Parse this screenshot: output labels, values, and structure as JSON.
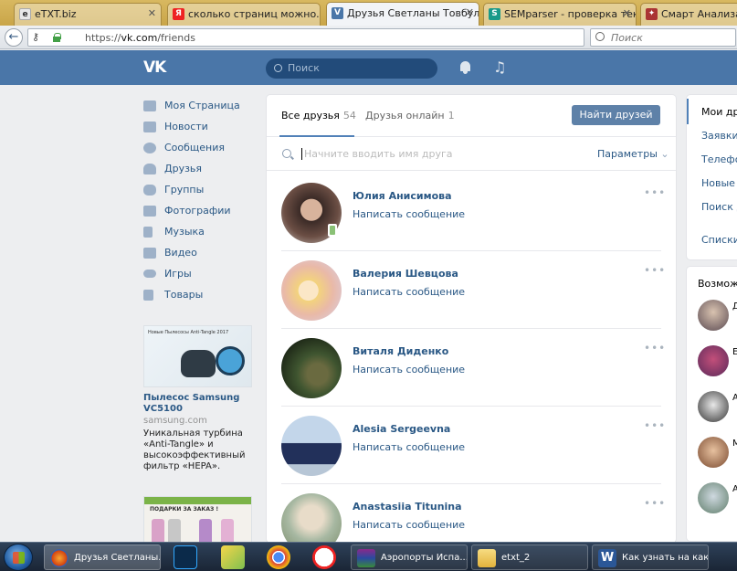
{
  "browser": {
    "tabs": [
      {
        "title": "eTXT.biz"
      },
      {
        "title": "сколько страниц можно..."
      },
      {
        "title": "Друзья Светланы Товбул..."
      },
      {
        "title": "SEMparser - проверка тек..."
      },
      {
        "title": "Смарт Анализатор"
      }
    ],
    "url_prefix": "https://",
    "url_host": "vk.com",
    "url_path": "/friends",
    "search_placeholder": "Поиск"
  },
  "vk": {
    "logo": "VK",
    "search_placeholder": "Поиск"
  },
  "sidebar": {
    "items": [
      {
        "label": "Моя Страница",
        "icon": "home-icon"
      },
      {
        "label": "Новости",
        "icon": "news-icon"
      },
      {
        "label": "Сообщения",
        "icon": "messages-icon"
      },
      {
        "label": "Друзья",
        "icon": "friends-icon"
      },
      {
        "label": "Группы",
        "icon": "groups-icon"
      },
      {
        "label": "Фотографии",
        "icon": "photos-icon"
      },
      {
        "label": "Музыка",
        "icon": "music-icon"
      },
      {
        "label": "Видео",
        "icon": "video-icon"
      },
      {
        "label": "Игры",
        "icon": "games-icon"
      },
      {
        "label": "Товары",
        "icon": "goods-icon"
      }
    ],
    "ad": {
      "image_caption": "Новые Пылесосы Anti-Tangle 2017",
      "title": "Пылесос Samsung VC5100",
      "domain": "samsung.com",
      "description": "Уникальная турбина «Anti-Tangle» и высокоэффективный фильтр «HEPA»."
    },
    "ad2": {
      "caption": "ПОДАРКИ ЗА ЗАКАЗ !"
    }
  },
  "friends": {
    "tab_all_label": "Все друзья",
    "tab_all_count": "54",
    "tab_online_label": "Друзья онлайн",
    "tab_online_count": "1",
    "find_button": "Найти друзей",
    "search_placeholder": "Начните вводить имя друга",
    "params_label": "Параметры",
    "message_label": "Написать сообщение",
    "list": [
      {
        "name": "Юлия Анисимова",
        "mobile": true
      },
      {
        "name": "Валерия Шевцова",
        "mobile": false
      },
      {
        "name": "Виталя Диденко",
        "mobile": false
      },
      {
        "name": "Alesia Sergeevna",
        "mobile": false
      },
      {
        "name": "Anastasiia Titunina",
        "mobile": false
      }
    ]
  },
  "right": {
    "menu": [
      {
        "label": "Мои друзья",
        "active": true
      },
      {
        "label": "Заявки"
      },
      {
        "label": "Телефоны"
      },
      {
        "label": "Новые друзья"
      },
      {
        "label": "Поиск друзей"
      },
      {
        "label": "Списки"
      }
    ],
    "suggest_title": "Возможные друзья",
    "suggest_initials": [
      "Д",
      "Е",
      "А",
      "М",
      "А"
    ]
  },
  "taskbar": {
    "items": [
      {
        "label": "Друзья Светланы..."
      },
      {
        "label": "Аэропорты Испа..."
      },
      {
        "label": "etxt_2"
      },
      {
        "label": "Как узнать на как..."
      }
    ]
  },
  "colors": {
    "vk_blue": "#4a76a8",
    "link": "#2a5885",
    "button": "#5e81a8"
  }
}
